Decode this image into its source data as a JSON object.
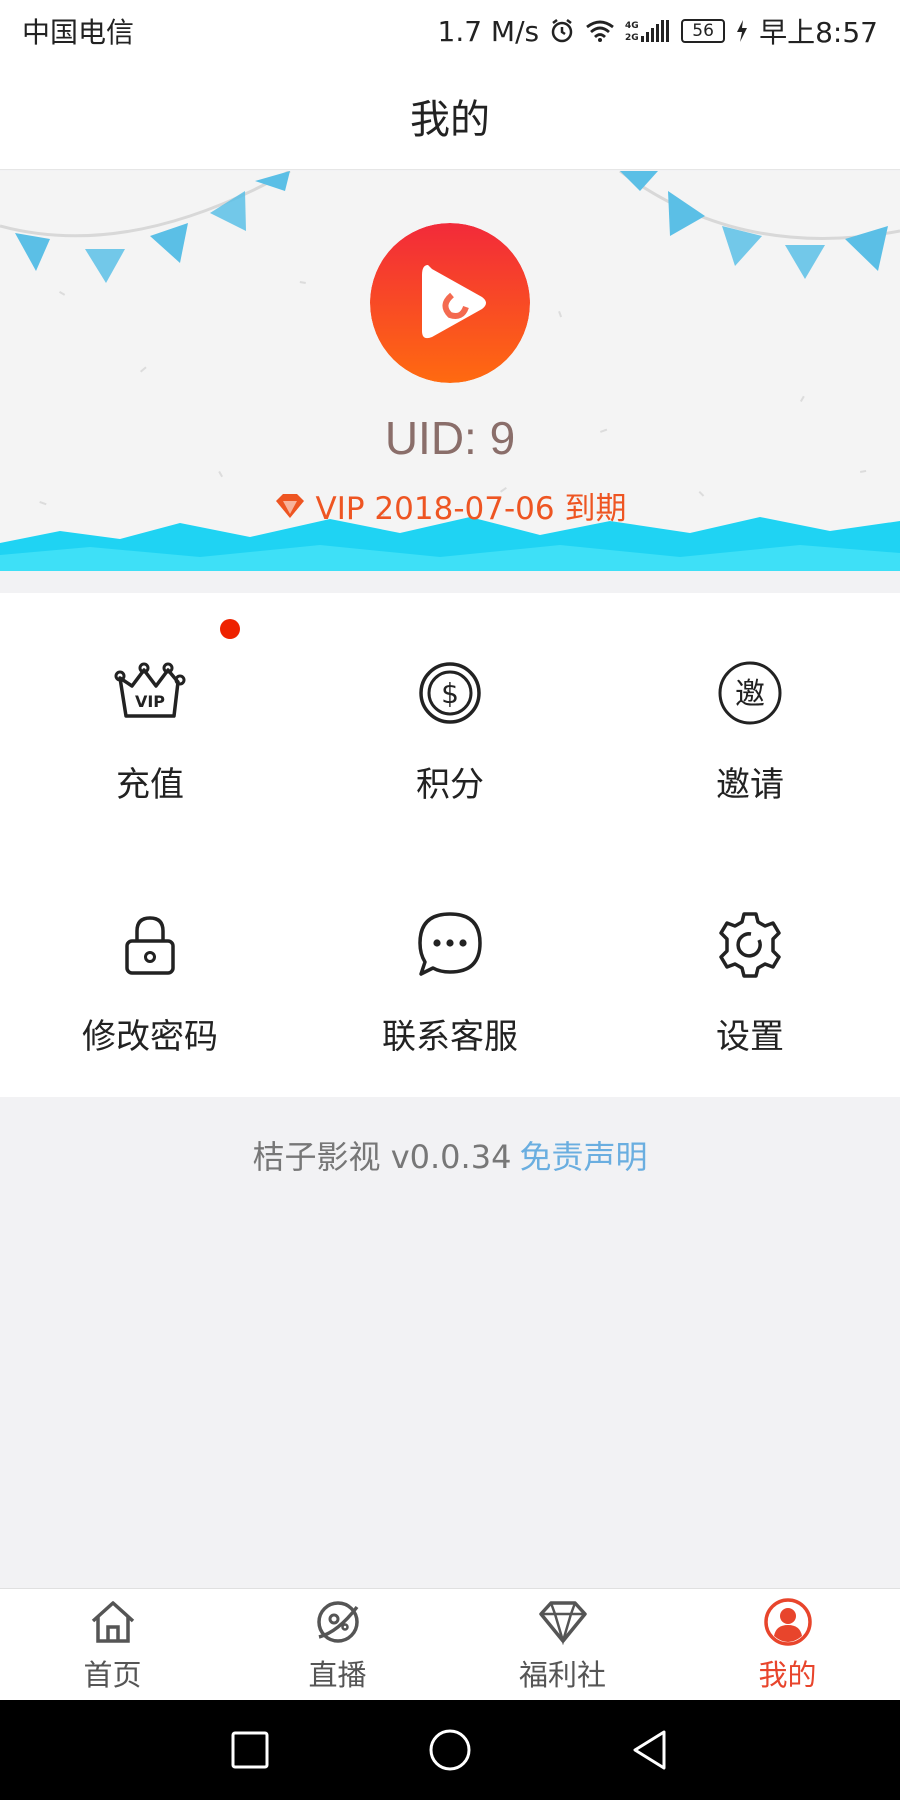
{
  "status_bar": {
    "carrier": "中国电信",
    "speed": "1.7 M/s",
    "network": "4G 2G",
    "battery": "56",
    "time": "早上8:57"
  },
  "header": {
    "title": "我的"
  },
  "profile": {
    "uid": "UID: 9",
    "vip_text": "VIP 2018-07-06 到期"
  },
  "menu": {
    "items": [
      {
        "label": "充值",
        "icon": "vip-crown-icon",
        "badge": true
      },
      {
        "label": "积分",
        "icon": "dollar-coin-icon"
      },
      {
        "label": "邀请",
        "icon": "invite-icon",
        "icon_text": "邀"
      },
      {
        "label": "修改密码",
        "icon": "lock-icon"
      },
      {
        "label": "联系客服",
        "icon": "chat-bubble-icon"
      },
      {
        "label": "设置",
        "icon": "gear-icon"
      }
    ]
  },
  "app_info": {
    "name_version": "桔子影视 v0.0.34",
    "disclaimer": "免责声明"
  },
  "tabbar": {
    "tabs": [
      {
        "label": "首页",
        "icon": "home-icon"
      },
      {
        "label": "直播",
        "icon": "planet-icon"
      },
      {
        "label": "福利社",
        "icon": "diamond-icon"
      },
      {
        "label": "我的",
        "icon": "profile-icon",
        "active": true
      }
    ]
  },
  "colors": {
    "accent": "#e8452c",
    "vip": "#ee5522",
    "uid": "#8a6e6a",
    "disclaimer_link": "#6aaee0",
    "wave": "#1fd3f3",
    "flag": "#5bbfe6"
  }
}
